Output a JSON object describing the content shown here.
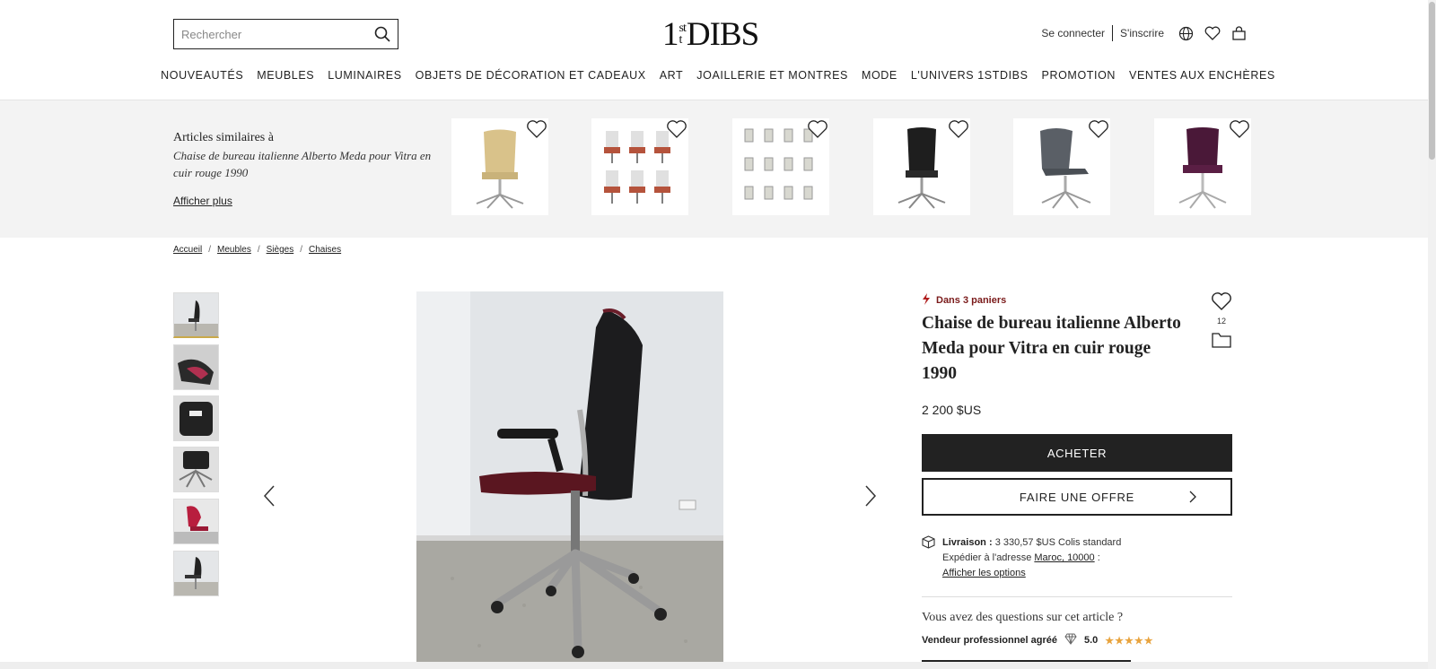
{
  "header": {
    "search_placeholder": "Rechercher",
    "logo": {
      "one": "1",
      "top": "st",
      "bottom": "DIBS",
      "mid": "t"
    },
    "login": "Se connecter",
    "signup": "S'inscrire"
  },
  "nav": [
    "NOUVEAUTÉS",
    "MEUBLES",
    "LUMINAIRES",
    "OBJETS DE DÉCORATION ET CADEAUX",
    "ART",
    "JOAILLERIE ET MONTRES",
    "MODE",
    "L'UNIVERS 1STDIBS",
    "PROMOTION",
    "VENTES AUX ENCHÈRES"
  ],
  "similar": {
    "title": "Articles similaires à",
    "subtitle": "Chaise de bureau italienne Alberto Meda pour Vitra en cuir rouge 1990",
    "more": "Afficher plus"
  },
  "breadcrumbs": [
    "Accueil",
    "Meubles",
    "Sièges",
    "Chaises"
  ],
  "product": {
    "badge": "Dans 3 paniers",
    "title": "Chaise de bureau italienne Alberto Meda pour Vitra en cuir rouge 1990",
    "favorites": "12",
    "price": "2 200 $US",
    "buy_label": "ACHETER",
    "offer_label": "FAIRE UNE OFFRE",
    "shipping_label": "Livraison :",
    "shipping_value": "3 330,57 $US Colis standard",
    "ship_to_prefix": "Expédier à l'adresse",
    "ship_to": "Maroc, 10000",
    "ship_to_suffix": ":",
    "options": "Afficher les options",
    "question": "Vous avez des questions sur cet article ?",
    "seller": "Vendeur professionnel agréé",
    "rating": "5.0",
    "stars": "★★★★★"
  },
  "colors": {
    "accent_red": "#7a1a1a",
    "star": "#e8a33d",
    "dark": "#222222"
  }
}
